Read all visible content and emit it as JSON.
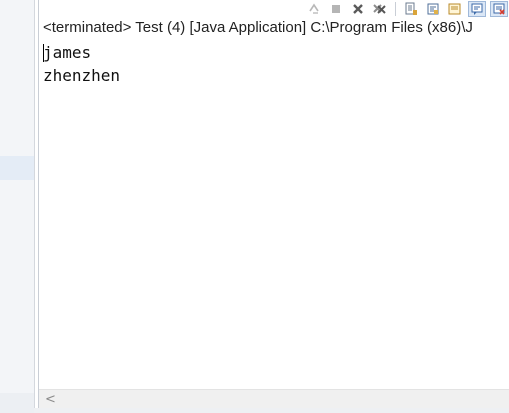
{
  "console": {
    "title": "<terminated> Test (4) [Java Application] C:\\Program Files (x86)\\J",
    "output_lines": [
      "james",
      "zhenzhen"
    ]
  },
  "toolbar": {
    "buttons": [
      {
        "icon": "relaunch-icon",
        "enabled": false
      },
      {
        "icon": "terminate-icon",
        "enabled": false
      },
      {
        "icon": "remove-launch-icon",
        "enabled": true
      },
      {
        "icon": "remove-all-terminated-icon",
        "enabled": true
      },
      {
        "icon": "scroll-lock-icon",
        "enabled": true
      },
      {
        "icon": "word-wrap-icon",
        "enabled": true
      },
      {
        "icon": "show-on-stdout-icon",
        "enabled": true
      },
      {
        "icon": "pin-console-icon",
        "enabled": true,
        "active": true
      },
      {
        "icon": "display-console-icon",
        "enabled": true,
        "active": true
      }
    ]
  },
  "scrollbar": {
    "left_arrow": "<"
  },
  "colors": {
    "accent": "#dbe7f6",
    "accent_border": "#9fb8d9",
    "red": "#d63b2f"
  }
}
